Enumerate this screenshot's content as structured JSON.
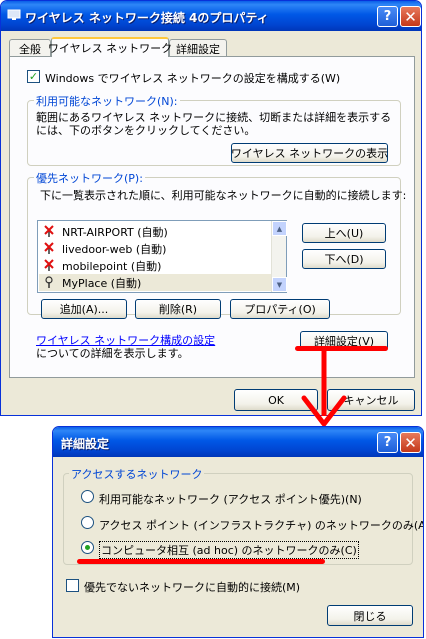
{
  "dialog1": {
    "title": "ワイヤレス ネットワーク接続 4のプロパティ",
    "tabs": [
      "全般",
      "ワイヤレス ネットワーク",
      "詳細設定"
    ],
    "use_windows_label": "Windows でワイヤレス ネットワークの設定を構成する(W)",
    "use_windows_checked": true,
    "available_group": {
      "legend": "利用可能なネットワーク(N):",
      "description": "範囲にあるワイヤレス ネットワークに接続、切断または詳細を表示するには、下のボタンをクリックしてください。",
      "view_button": "ワイヤレス ネットワークの表示"
    },
    "preferred_group": {
      "legend": "優先ネットワーク(P):",
      "description": "下に一覧表示された順に、利用可能なネットワークに自動的に接続します:",
      "networks": [
        {
          "label": "NRT-AIRPORT (自動)",
          "icon": "antenna-disabled-icon"
        },
        {
          "label": "livedoor-web (自動)",
          "icon": "antenna-disabled-icon"
        },
        {
          "label": "mobilepoint (自動)",
          "icon": "antenna-disabled-icon"
        },
        {
          "label": "MyPlace (自動)",
          "icon": "antenna-icon"
        }
      ],
      "up_button": "上へ(U)",
      "down_button": "下へ(D)",
      "add_button": "追加(A)...",
      "remove_button": "削除(R)",
      "properties_button": "プロパティ(O)"
    },
    "config_link": "ワイヤレス ネットワーク構成の設定",
    "config_text": "についての詳細を表示します。",
    "advanced_button": "詳細設定(V)",
    "ok_button": "OK",
    "cancel_button": "キャンセル"
  },
  "dialog2": {
    "title": "詳細設定",
    "group_legend": "アクセスするネットワーク",
    "options": [
      {
        "label": "利用可能なネットワーク (アクセス ポイント優先)(N)",
        "selected": false
      },
      {
        "label": "アクセス ポイント (インフラストラクチャ) のネットワークのみ(A)",
        "selected": false
      },
      {
        "label": "コンピュータ相互 (ad hoc) のネットワークのみ(C)",
        "selected": true
      }
    ],
    "auto_connect_label": "優先でないネットワークに自動的に接続(M)",
    "auto_connect_checked": false,
    "close_button": "閉じる"
  },
  "colors": {
    "annotation": "#ff0000",
    "title_bar": "#0058e6",
    "dialog_face": "#ece9d8"
  }
}
